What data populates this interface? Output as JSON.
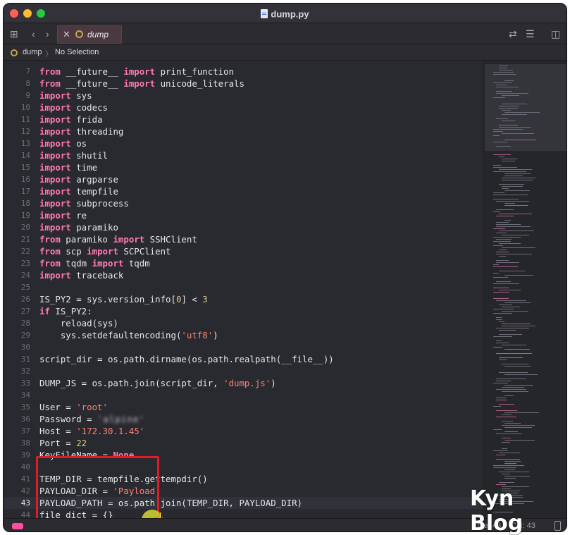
{
  "window": {
    "title": "dump.py"
  },
  "tabbar": {
    "active_tab": "dump",
    "tab_icon": "python-file-icon"
  },
  "jumpbar": {
    "file": "dump",
    "separator": "〉",
    "selection": "No Selection"
  },
  "editor": {
    "current_line": 43,
    "lines": [
      {
        "num": "7",
        "tokens": [
          [
            "from",
            "kw"
          ],
          [
            " __future__ ",
            ""
          ],
          [
            "import",
            "kw"
          ],
          [
            " print_function",
            ""
          ]
        ]
      },
      {
        "num": "8",
        "tokens": [
          [
            "from",
            "kw"
          ],
          [
            " __future__ ",
            ""
          ],
          [
            "import",
            "kw"
          ],
          [
            " unicode_literals",
            ""
          ]
        ]
      },
      {
        "num": "9",
        "tokens": [
          [
            "import",
            "kw"
          ],
          [
            " sys",
            ""
          ]
        ]
      },
      {
        "num": "10",
        "tokens": [
          [
            "import",
            "kw"
          ],
          [
            " codecs",
            ""
          ]
        ]
      },
      {
        "num": "11",
        "tokens": [
          [
            "import",
            "kw"
          ],
          [
            " frida",
            ""
          ]
        ]
      },
      {
        "num": "12",
        "tokens": [
          [
            "import",
            "kw"
          ],
          [
            " threading",
            ""
          ]
        ]
      },
      {
        "num": "13",
        "tokens": [
          [
            "import",
            "kw"
          ],
          [
            " os",
            ""
          ]
        ]
      },
      {
        "num": "14",
        "tokens": [
          [
            "import",
            "kw"
          ],
          [
            " shutil",
            ""
          ]
        ]
      },
      {
        "num": "15",
        "tokens": [
          [
            "import",
            "kw"
          ],
          [
            " time",
            ""
          ]
        ]
      },
      {
        "num": "16",
        "tokens": [
          [
            "import",
            "kw"
          ],
          [
            " argparse",
            ""
          ]
        ]
      },
      {
        "num": "17",
        "tokens": [
          [
            "import",
            "kw"
          ],
          [
            " tempfile",
            ""
          ]
        ]
      },
      {
        "num": "18",
        "tokens": [
          [
            "import",
            "kw"
          ],
          [
            " subprocess",
            ""
          ]
        ]
      },
      {
        "num": "19",
        "tokens": [
          [
            "import",
            "kw"
          ],
          [
            " re",
            ""
          ]
        ]
      },
      {
        "num": "20",
        "tokens": [
          [
            "import",
            "kw"
          ],
          [
            " paramiko",
            ""
          ]
        ]
      },
      {
        "num": "21",
        "tokens": [
          [
            "from",
            "kw"
          ],
          [
            " paramiko ",
            ""
          ],
          [
            "import",
            "kw"
          ],
          [
            " SSHClient",
            ""
          ]
        ]
      },
      {
        "num": "22",
        "tokens": [
          [
            "from",
            "kw"
          ],
          [
            " scp ",
            ""
          ],
          [
            "import",
            "kw"
          ],
          [
            " SCPClient",
            ""
          ]
        ]
      },
      {
        "num": "23",
        "tokens": [
          [
            "from",
            "kw"
          ],
          [
            " tqdm ",
            ""
          ],
          [
            "import",
            "kw"
          ],
          [
            " tqdm",
            ""
          ]
        ]
      },
      {
        "num": "24",
        "tokens": [
          [
            "import",
            "kw"
          ],
          [
            " traceback",
            ""
          ]
        ]
      },
      {
        "num": "25",
        "tokens": []
      },
      {
        "num": "26",
        "tokens": [
          [
            "IS_PY2 = sys.version_info[",
            ""
          ],
          [
            "0",
            "nu"
          ],
          [
            "] < ",
            ""
          ],
          [
            "3",
            "nu"
          ]
        ]
      },
      {
        "num": "27",
        "tokens": [
          [
            "if",
            "kw"
          ],
          [
            " IS_PY2:",
            ""
          ]
        ]
      },
      {
        "num": "28",
        "tokens": [
          [
            "    reload(sys)",
            ""
          ]
        ]
      },
      {
        "num": "29",
        "tokens": [
          [
            "    sys.setdefaultencoding(",
            ""
          ],
          [
            "'utf8'",
            "st"
          ],
          [
            ")",
            ""
          ]
        ]
      },
      {
        "num": "30",
        "tokens": []
      },
      {
        "num": "31",
        "tokens": [
          [
            "script_dir = os.path.dirname(os.path.realpath(__file__))",
            ""
          ]
        ]
      },
      {
        "num": "32",
        "tokens": []
      },
      {
        "num": "33",
        "tokens": [
          [
            "DUMP_JS = os.path.join(script_dir, ",
            ""
          ],
          [
            "'dump.js'",
            "st"
          ],
          [
            ")",
            ""
          ]
        ]
      },
      {
        "num": "34",
        "tokens": []
      },
      {
        "num": "35",
        "tokens": [
          [
            "User = ",
            ""
          ],
          [
            "'root'",
            "st"
          ]
        ]
      },
      {
        "num": "36",
        "tokens": [
          [
            "Password = ",
            ""
          ],
          [
            "'alpine'",
            "blur"
          ]
        ]
      },
      {
        "num": "37",
        "tokens": [
          [
            "Host = ",
            ""
          ],
          [
            "'172.30.1.45'",
            "st"
          ]
        ]
      },
      {
        "num": "38",
        "tokens": [
          [
            "Port = ",
            ""
          ],
          [
            "22",
            "nu"
          ]
        ]
      },
      {
        "num": "39",
        "tokens": [
          [
            "KeyFileName = ",
            ""
          ],
          [
            "None",
            "kw"
          ]
        ]
      },
      {
        "num": "40",
        "tokens": []
      },
      {
        "num": "41",
        "tokens": [
          [
            "TEMP_DIR = tempfile.gettempdir()",
            ""
          ]
        ]
      },
      {
        "num": "42",
        "tokens": [
          [
            "PAYLOAD_DIR = ",
            ""
          ],
          [
            "'Payload'",
            "st"
          ]
        ]
      },
      {
        "num": "43",
        "tokens": [
          [
            "PAYLOAD_PATH = os.path.join(TEMP_DIR, PAYLOAD_DIR)",
            ""
          ]
        ]
      },
      {
        "num": "44",
        "tokens": [
          [
            "file_dict = {}",
            ""
          ]
        ]
      }
    ]
  },
  "statusbar": {
    "line": "Line: 43",
    "col": "Col: 43"
  },
  "watermark": "Kyn Blog",
  "colors": {
    "keyword": "#ff7ab2",
    "string": "#ff8170",
    "number": "#d9c97c",
    "highlight_box": "#e21c26",
    "background": "#292a30"
  }
}
